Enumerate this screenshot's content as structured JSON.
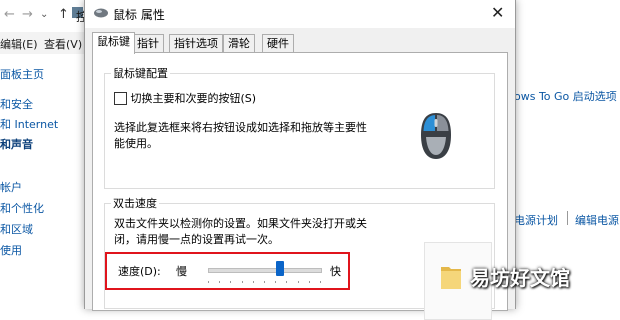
{
  "background": {
    "toolbar": {
      "path_text": "控"
    },
    "menu": {
      "edit": "编辑(E)",
      "view": "查看(V)"
    },
    "sidebar_items": [
      {
        "label": "面板主页"
      },
      {
        "label": "和安全"
      },
      {
        "label": "和 Internet"
      },
      {
        "label": "和声音"
      },
      {
        "label": "帐户"
      },
      {
        "label": "和个性化"
      },
      {
        "label": "和区域"
      },
      {
        "label": "使用"
      }
    ],
    "right_link_windows_to_go": "ows To Go 启动选项",
    "right_link_power_plan": "电源计划",
    "right_link_edit_power": "编辑电源"
  },
  "dialog": {
    "title": "鼠标 属性",
    "tabs": [
      {
        "label": "鼠标键",
        "active": true
      },
      {
        "label": "指针",
        "active": false
      },
      {
        "label": "指针选项",
        "active": false
      },
      {
        "label": "滑轮",
        "active": false
      },
      {
        "label": "硬件",
        "active": false
      }
    ],
    "button_config": {
      "legend": "鼠标键配置",
      "checkbox_label": "切换主要和次要的按钮(S)",
      "checked": false,
      "description_line1": "选择此复选框来将右按钮设成如选择和拖放等主要性",
      "description_line2": "能使用。"
    },
    "double_click": {
      "legend": "双击速度",
      "description_line1": "双击文件夹以检测你的设置。如果文件夹没打开或关",
      "description_line2": "闭，请用慢一点的设置再试一次。",
      "speed_label": "速度(D):",
      "slow_label": "慢",
      "fast_label": "快",
      "speed_value_fraction": 0.64
    }
  },
  "watermark": {
    "text": "易坊好文馆"
  },
  "colors": {
    "accent": "#0a64c8",
    "highlight": "#e0141c",
    "link": "#0b57a4"
  }
}
